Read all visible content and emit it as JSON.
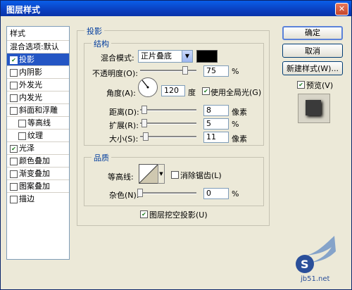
{
  "window": {
    "title": "图层样式"
  },
  "sidebar": {
    "header": "样式",
    "blend_default": "混合选项:默认",
    "items": [
      {
        "label": "投影",
        "checked": true,
        "selected": true
      },
      {
        "label": "内阴影",
        "checked": false
      },
      {
        "label": "外发光",
        "checked": false
      },
      {
        "label": "内发光",
        "checked": false
      },
      {
        "label": "斜面和浮雕",
        "checked": false
      },
      {
        "label": "等高线",
        "checked": false
      },
      {
        "label": "纹理",
        "checked": false
      },
      {
        "label": "光泽",
        "checked": true
      },
      {
        "label": "颜色叠加",
        "checked": false
      },
      {
        "label": "渐变叠加",
        "checked": false
      },
      {
        "label": "图案叠加",
        "checked": false
      },
      {
        "label": "描边",
        "checked": false
      }
    ]
  },
  "drop_shadow": {
    "section_title": "投影",
    "structure": {
      "title": "结构",
      "blend_mode_label": "混合模式:",
      "blend_mode_value": "正片叠底",
      "shadow_color": "#000000",
      "opacity_label": "不透明度(O):",
      "opacity_value": "75",
      "opacity_unit": "%",
      "opacity_level": 0.75,
      "angle_label": "角度(A):",
      "angle_value": "120",
      "angle_unit": "度",
      "global_light_label": "使用全局光(G)",
      "global_light_checked": true,
      "distance_label": "距离(D):",
      "distance_value": "8",
      "distance_unit": "像素",
      "spread_label": "扩展(R):",
      "spread_value": "5",
      "spread_unit": "%",
      "size_label": "大小(S):",
      "size_value": "11",
      "size_unit": "像素"
    },
    "quality": {
      "title": "品质",
      "contour_label": "等高线:",
      "anti_alias_label": "消除锯齿(L)",
      "anti_alias_checked": false,
      "noise_label": "杂色(N):",
      "noise_value": "0",
      "noise_unit": "%"
    },
    "knockout_label": "图层挖空投影(U)",
    "knockout_checked": true
  },
  "buttons": {
    "ok": "确定",
    "cancel": "取消",
    "new_style": "新建样式(W)...",
    "preview_label": "预览(V)",
    "preview_checked": true
  },
  "watermark_text": "jb51.net"
}
